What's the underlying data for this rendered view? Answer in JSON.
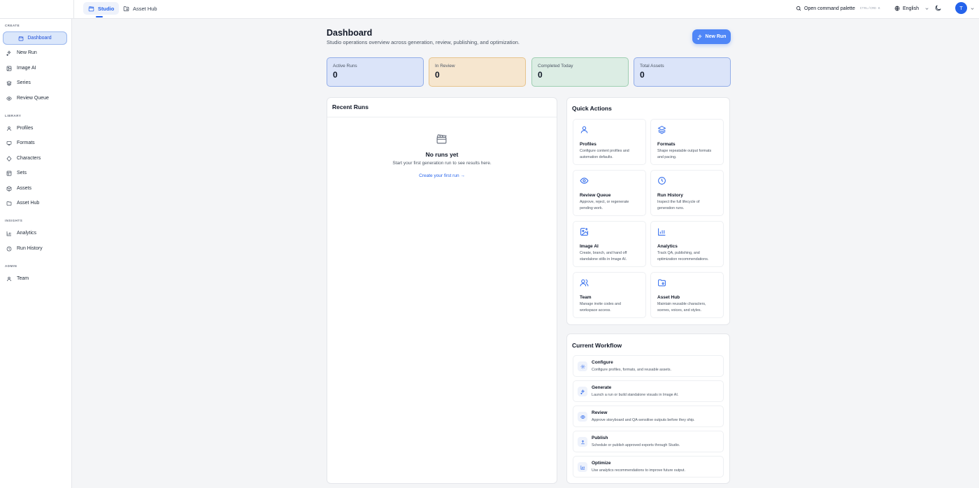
{
  "topbar": {
    "tabs": [
      {
        "label": "Studio",
        "icon": "clapperboard-icon"
      },
      {
        "label": "Asset Hub",
        "icon": "folder-icon"
      }
    ],
    "command_palette": "Open command palette",
    "shortcut": "CTRL/CMD K",
    "language": "English",
    "avatar_initial": "T"
  },
  "sidebar": {
    "sections": [
      {
        "label": "CREATE",
        "items": [
          "Dashboard",
          "New Run",
          "Image AI",
          "Series",
          "Review Queue"
        ]
      },
      {
        "label": "LIBRARY",
        "items": [
          "Profiles",
          "Formats",
          "Characters",
          "Sets",
          "Assets",
          "Asset Hub"
        ]
      },
      {
        "label": "INSIGHTS",
        "items": [
          "Analytics",
          "Run History"
        ]
      },
      {
        "label": "ADMIN",
        "items": [
          "Team"
        ]
      }
    ],
    "active": "Dashboard"
  },
  "header": {
    "title": "Dashboard",
    "subtitle": "Studio operations overview across generation, review, publishing, and optimization.",
    "new_run": "New Run"
  },
  "stats": [
    {
      "label": "Active Runs",
      "value": "0",
      "color": "#dbe4f9"
    },
    {
      "label": "In Review",
      "value": "0",
      "color": "#f6e6cf"
    },
    {
      "label": "Completed Today",
      "value": "0",
      "color": "#dcede4"
    },
    {
      "label": "Total Assets",
      "value": "0",
      "color": "#dbe4f9"
    }
  ],
  "recent_runs": {
    "title": "Recent Runs",
    "empty_title": "No runs yet",
    "empty_desc": "Start your first generation run to see results here.",
    "link": "Create your first run →"
  },
  "quick_actions": {
    "title": "Quick Actions",
    "items": [
      {
        "title": "Profiles",
        "desc": "Configure content profiles and automation defaults.",
        "icon": "user-icon"
      },
      {
        "title": "Formats",
        "desc": "Shape repeatable output formats and pacing.",
        "icon": "layers-icon"
      },
      {
        "title": "Review Queue",
        "desc": "Approve, reject, or regenerate pending work.",
        "icon": "eye-icon"
      },
      {
        "title": "Run History",
        "desc": "Inspect the full lifecycle of generation runs.",
        "icon": "clock-icon"
      },
      {
        "title": "Image AI",
        "desc": "Create, branch, and hand off standalone stills in Image AI.",
        "icon": "image-plus-icon"
      },
      {
        "title": "Analytics",
        "desc": "Track QA, publishing, and optimization recommendations.",
        "icon": "bar-chart-icon"
      },
      {
        "title": "Team",
        "desc": "Manage invite codes and workspace access.",
        "icon": "users-icon"
      },
      {
        "title": "Asset Hub",
        "desc": "Maintain reusable characters, scenes, voices, and styles.",
        "icon": "folder-icon"
      }
    ]
  },
  "workflow": {
    "title": "Current Workflow",
    "steps": [
      {
        "title": "Configure",
        "desc": "Configure profiles, formats, and reusable assets.",
        "icon": "gear-icon"
      },
      {
        "title": "Generate",
        "desc": "Launch a run or build standalone visuals in Image AI.",
        "icon": "sparkles-icon"
      },
      {
        "title": "Review",
        "desc": "Approve storyboard and QA-sensitive outputs before they ship.",
        "icon": "eye-icon"
      },
      {
        "title": "Publish",
        "desc": "Schedule or publish approved exports through Studio.",
        "icon": "upload-icon"
      },
      {
        "title": "Optimize",
        "desc": "Use analytics recommendations to improve future output.",
        "icon": "bar-chart-icon"
      }
    ]
  },
  "colors": {
    "accent": "#2563eb",
    "button": "#4f86f7"
  }
}
